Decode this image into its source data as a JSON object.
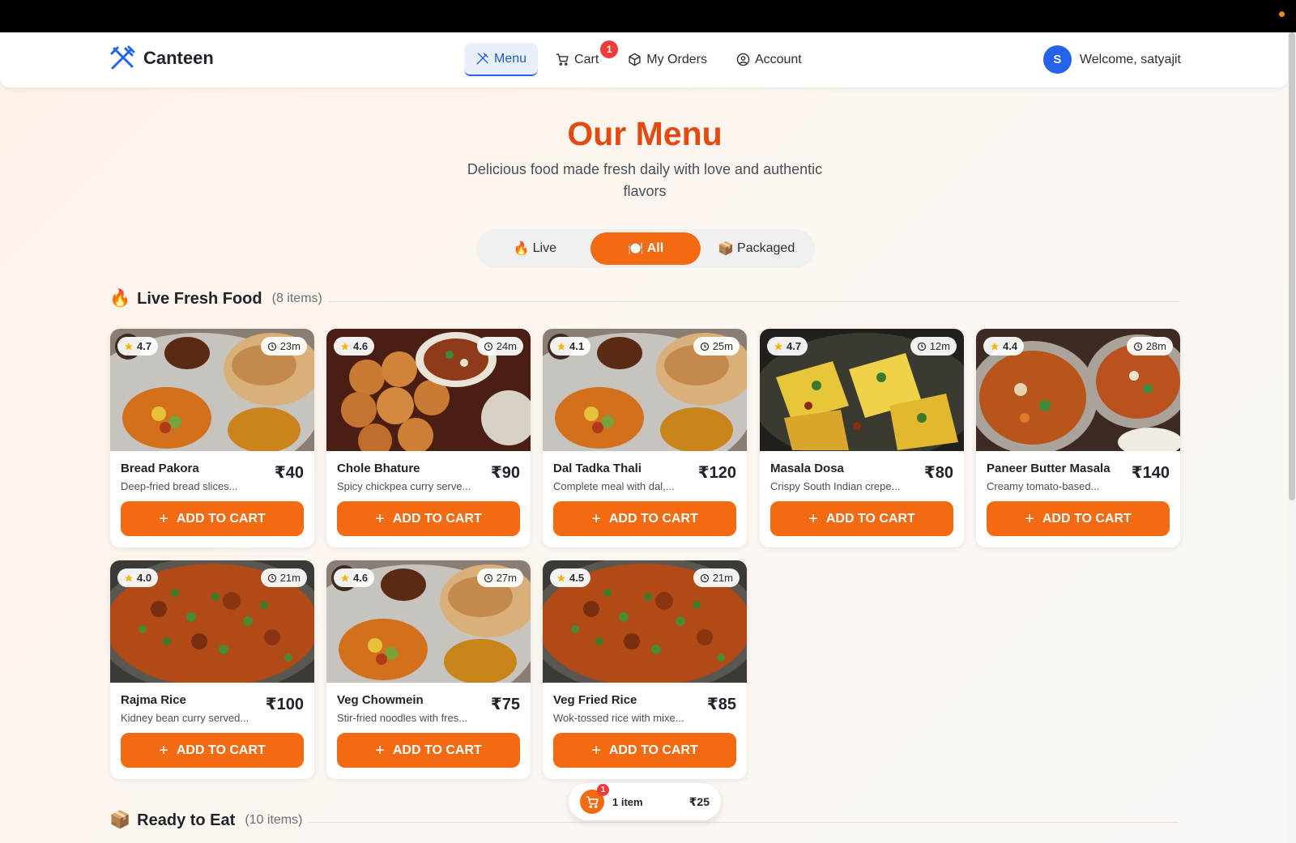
{
  "app": {
    "name": "Canteen"
  },
  "nav": {
    "items": [
      {
        "label": "Menu",
        "icon": "utensils-icon",
        "active": true
      },
      {
        "label": "Cart",
        "icon": "cart-icon",
        "badge": "1"
      },
      {
        "label": "My Orders",
        "icon": "package-icon"
      },
      {
        "label": "Account",
        "icon": "user-circle-icon"
      }
    ]
  },
  "user": {
    "initial": "S",
    "welcome": "Welcome, satyajit"
  },
  "hero": {
    "title": "Our Menu",
    "subtitle": "Delicious food made fresh daily with love and authentic flavors"
  },
  "filters": [
    {
      "emoji": "🔥",
      "label": "Live"
    },
    {
      "emoji": "🍽️",
      "label": "All",
      "active": true
    },
    {
      "emoji": "📦",
      "label": "Packaged"
    }
  ],
  "sections": {
    "live": {
      "emoji": "🔥",
      "title": "Live Fresh Food",
      "count": "(8 items)"
    },
    "ready": {
      "emoji": "📦",
      "title": "Ready to Eat",
      "count": "(10 items)"
    }
  },
  "add_label": "ADD TO CART",
  "items": [
    {
      "name": "Bread Pakora",
      "price": "₹40",
      "desc": "Deep-fried bread slices...",
      "rating": "4.7",
      "time": "23m",
      "img": "thali"
    },
    {
      "name": "Chole Bhature",
      "price": "₹90",
      "desc": "Spicy chickpea curry serve...",
      "rating": "4.6",
      "time": "24m",
      "img": "pav"
    },
    {
      "name": "Dal Tadka Thali",
      "price": "₹120",
      "desc": "Complete meal with dal,...",
      "rating": "4.1",
      "time": "25m",
      "img": "thali"
    },
    {
      "name": "Masala Dosa",
      "price": "₹80",
      "desc": "Crispy South Indian crepe...",
      "rating": "4.7",
      "time": "12m",
      "img": "paneer"
    },
    {
      "name": "Paneer Butter Masala",
      "price": "₹140",
      "desc": "Creamy tomato-based...",
      "rating": "4.4",
      "time": "28m",
      "img": "curry"
    },
    {
      "name": "Rajma Rice",
      "price": "₹100",
      "desc": "Kidney bean curry served...",
      "rating": "4.0",
      "time": "21m",
      "img": "gravy"
    },
    {
      "name": "Veg Chowmein",
      "price": "₹75",
      "desc": "Stir-fried noodles with fres...",
      "rating": "4.6",
      "time": "27m",
      "img": "thali"
    },
    {
      "name": "Veg Fried Rice",
      "price": "₹85",
      "desc": "Wok-tossed rice with mixe...",
      "rating": "4.5",
      "time": "21m",
      "img": "gravy"
    }
  ],
  "mini_cart": {
    "badge": "1",
    "items": "1 item",
    "total": "₹25"
  },
  "colors": {
    "accent": "#f26a12",
    "brand_blue": "#2563eb",
    "title_orange": "#e24a12",
    "badge_red": "#ef3b3b"
  }
}
